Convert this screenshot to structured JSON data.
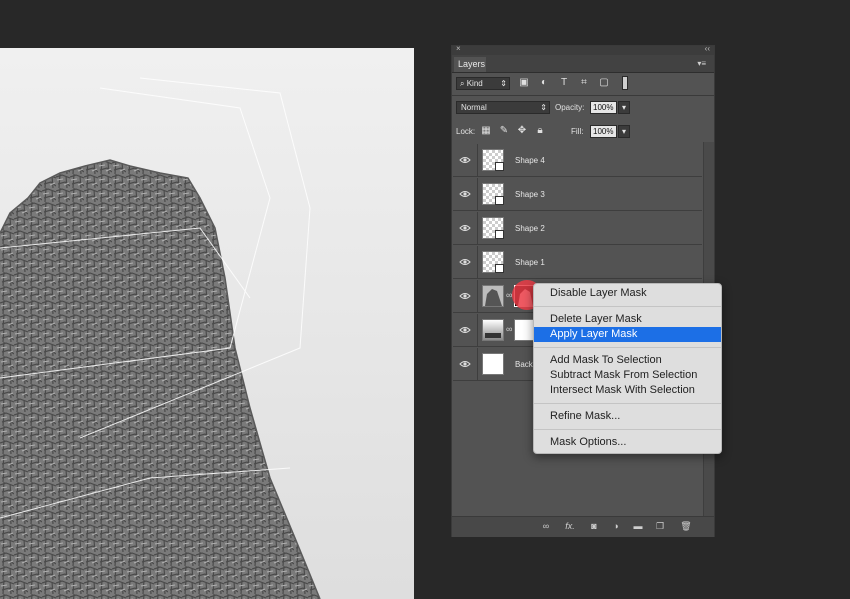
{
  "panel": {
    "title_close": "×",
    "title_collapse": "‹‹",
    "tab_label": "Layers",
    "menu_glyph": "▾≡"
  },
  "filter": {
    "kind_label": "Kind",
    "kind_icon": "search-icon"
  },
  "blend": {
    "mode": "Normal",
    "opacity_label": "Opacity:",
    "opacity_value": "100%"
  },
  "lock": {
    "label": "Lock:",
    "fill_label": "Fill:",
    "fill_value": "100%"
  },
  "layers": [
    {
      "name": "Shape 4",
      "type": "shape"
    },
    {
      "name": "Shape 3",
      "type": "shape"
    },
    {
      "name": "Shape 2",
      "type": "shape"
    },
    {
      "name": "Shape 1",
      "type": "shape"
    },
    {
      "name": "",
      "type": "image-with-mask"
    },
    {
      "name": "",
      "type": "gradient-with-mask"
    },
    {
      "name": "Backgr",
      "type": "background"
    }
  ],
  "context_menu": {
    "items": [
      {
        "label": "Disable Layer Mask",
        "highlighted": false
      },
      {
        "label": "Delete Layer Mask",
        "highlighted": false
      },
      {
        "label": "Apply Layer Mask",
        "highlighted": true
      },
      {
        "label": "Add Mask To Selection",
        "highlighted": false
      },
      {
        "label": "Subtract Mask From Selection",
        "highlighted": false
      },
      {
        "label": "Intersect Mask With Selection",
        "highlighted": false
      },
      {
        "label": "Refine Mask...",
        "highlighted": false
      },
      {
        "label": "Mask Options...",
        "highlighted": false
      }
    ],
    "highlight_color": "#1c6fe6"
  },
  "bottom_icons": [
    "link-icon",
    "fx-icon",
    "mask-icon",
    "adjustment-icon",
    "folder-icon",
    "new-layer-icon",
    "trash-icon"
  ],
  "bottom_fx": "fx.",
  "colors": {
    "app_bg": "#282828",
    "panel_bg": "#535353",
    "cursor": "#eb3c46"
  }
}
